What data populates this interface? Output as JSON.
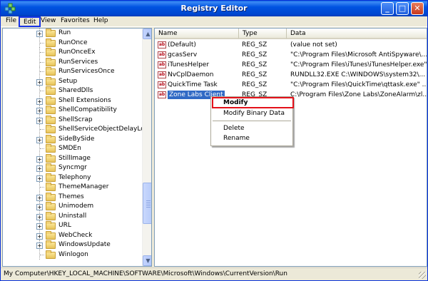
{
  "window": {
    "title": "Registry Editor",
    "minimize_glyph": "_",
    "maximize_glyph": "□",
    "close_glyph": "✕"
  },
  "menu": [
    "File",
    "Edit",
    "View",
    "Favorites",
    "Help"
  ],
  "tree": {
    "items": [
      {
        "label": "Run",
        "expandable": true
      },
      {
        "label": "RunOnce",
        "expandable": false
      },
      {
        "label": "RunOnceEx",
        "expandable": false
      },
      {
        "label": "RunServices",
        "expandable": false
      },
      {
        "label": "RunServicesOnce",
        "expandable": false
      },
      {
        "label": "Setup",
        "expandable": true
      },
      {
        "label": "SharedDlls",
        "expandable": false
      },
      {
        "label": "Shell Extensions",
        "expandable": true
      },
      {
        "label": "ShellCompatibility",
        "expandable": true
      },
      {
        "label": "ShellScrap",
        "expandable": true
      },
      {
        "label": "ShellServiceObjectDelayLoad",
        "expandable": false
      },
      {
        "label": "SideBySide",
        "expandable": true
      },
      {
        "label": "SMDEn",
        "expandable": false
      },
      {
        "label": "StillImage",
        "expandable": true
      },
      {
        "label": "Syncmgr",
        "expandable": true
      },
      {
        "label": "Telephony",
        "expandable": true
      },
      {
        "label": "ThemeManager",
        "expandable": false
      },
      {
        "label": "Themes",
        "expandable": true
      },
      {
        "label": "Unimodem",
        "expandable": true
      },
      {
        "label": "Uninstall",
        "expandable": true
      },
      {
        "label": "URL",
        "expandable": true
      },
      {
        "label": "WebCheck",
        "expandable": true
      },
      {
        "label": "WindowsUpdate",
        "expandable": true
      },
      {
        "label": "Winlogon",
        "expandable": false
      }
    ]
  },
  "list": {
    "columns": [
      "Name",
      "Type",
      "Data"
    ],
    "rows": [
      {
        "name": "(Default)",
        "type": "REG_SZ",
        "data": "(value not set)"
      },
      {
        "name": "gcasServ",
        "type": "REG_SZ",
        "data": "\"C:\\Program Files\\Microsoft AntiSpyware\\..."
      },
      {
        "name": "iTunesHelper",
        "type": "REG_SZ",
        "data": "\"C:\\Program Files\\iTunes\\iTunesHelper.exe\""
      },
      {
        "name": "NvCplDaemon",
        "type": "REG_SZ",
        "data": "RUNDLL32.EXE C:\\WINDOWS\\system32\\..."
      },
      {
        "name": "QuickTime Task",
        "type": "REG_SZ",
        "data": "\"C:\\Program Files\\QuickTime\\qttask.exe\" ..."
      },
      {
        "name": "Zone Labs Client",
        "type": "REG_SZ",
        "data": "C:\\Program Files\\Zone Labs\\ZoneAlarm\\zl..."
      }
    ],
    "selected_index": 5,
    "icon_text": "ab"
  },
  "context_menu": {
    "items": [
      "Modify",
      "Modify Binary Data",
      "Delete",
      "Rename"
    ],
    "default_item": "Modify"
  },
  "status_bar": {
    "path": "My Computer\\HKEY_LOCAL_MACHINE\\SOFTWARE\\Microsoft\\Windows\\CurrentVersion\\Run"
  },
  "colors": {
    "title_bar": "#0053e1",
    "selection": "#316ac5",
    "highlight_box_menu": "#1733e6",
    "highlight_box_context": "#e3111a"
  }
}
